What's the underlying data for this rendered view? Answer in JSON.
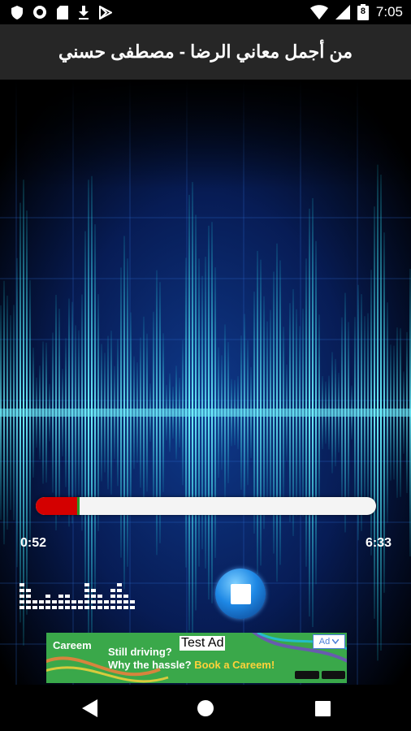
{
  "status_bar": {
    "time": "7:05",
    "battery_level": "8",
    "left_icons": [
      "shield-icon",
      "circle-icon",
      "sd-card-icon",
      "download-icon",
      "play-store-icon"
    ],
    "right_icons": [
      "wifi-icon",
      "signal-icon",
      "battery-icon"
    ]
  },
  "header": {
    "title": "من أجمل معاني الرضا - مصطفى حسني"
  },
  "player": {
    "progress_fraction": 0.13,
    "elapsed": "0:52",
    "total": "6:33",
    "stop_button_icon": "stop-icon",
    "equalizer_icon": "equalizer-icon"
  },
  "ad": {
    "brand": "Careem",
    "line1": "Still driving?",
    "line2_prefix": "Why the hassle?",
    "line2_cta": "Book a Careem!",
    "test_label": "Test Ad",
    "badge": "Ad"
  },
  "nav_bar": {
    "back_icon": "back-icon",
    "home_icon": "home-icon",
    "recents_icon": "recents-icon"
  },
  "colors": {
    "title_bar": "#262626",
    "progress_fill": "#d40000",
    "progress_track": "#f4f4f4",
    "ad_background": "#3aa84a",
    "wave": "#19c6d8"
  }
}
